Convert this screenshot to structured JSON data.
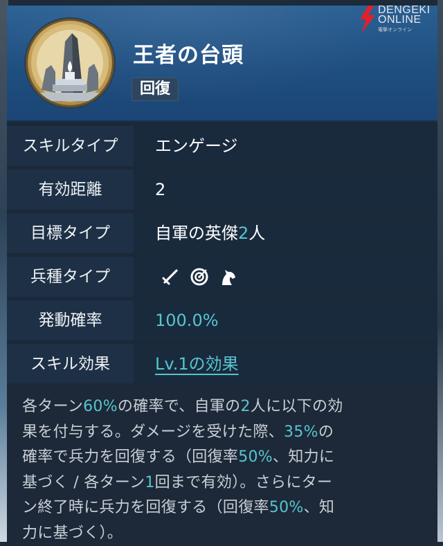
{
  "skill": {
    "name": "王者の台頭",
    "category": "回復",
    "emblem": "tower-monument-icon"
  },
  "watermark": {
    "line1": "DENGEKI",
    "line2": "ONLINE",
    "line3": "電撃オンライン",
    "icon": "lightning-bolt-icon"
  },
  "rows": [
    {
      "label": "スキルタイプ",
      "value": "エンゲージ"
    },
    {
      "label": "有効距離",
      "value": "2"
    },
    {
      "label": "目標タイプ",
      "value_prefix": "自軍の英傑",
      "value_highlight": "2",
      "value_suffix": "人"
    },
    {
      "label": "兵種タイプ",
      "icons": [
        "sword-icon",
        "target-icon",
        "horse-icon"
      ]
    },
    {
      "label": "発動確率",
      "value": "100.0%"
    },
    {
      "label": "スキル効果",
      "value": "Lv.1の効果"
    }
  ],
  "description": [
    {
      "t": "各ターン"
    },
    {
      "t": "60%",
      "hl": true
    },
    {
      "t": "の確率で、自軍の"
    },
    {
      "t": "2",
      "hl": true
    },
    {
      "t": "人に以下の効\n果を付与する。ダメージを受けた際、"
    },
    {
      "t": "35%",
      "hl": true
    },
    {
      "t": "の\n確率で兵力を回復する（回復率"
    },
    {
      "t": "50%",
      "hl": true
    },
    {
      "t": "、知力に\n基づく / 各ターン"
    },
    {
      "t": "1",
      "hl": true
    },
    {
      "t": "回まで有効）。さらにター\nン終了時に兵力を回復する（回復率"
    },
    {
      "t": "50%",
      "hl": true
    },
    {
      "t": "、知\n力に基づく）。"
    }
  ],
  "colors": {
    "highlight": "#56c6cf",
    "header": "#1f4f80",
    "emblem_gold": "#c9a45c"
  }
}
